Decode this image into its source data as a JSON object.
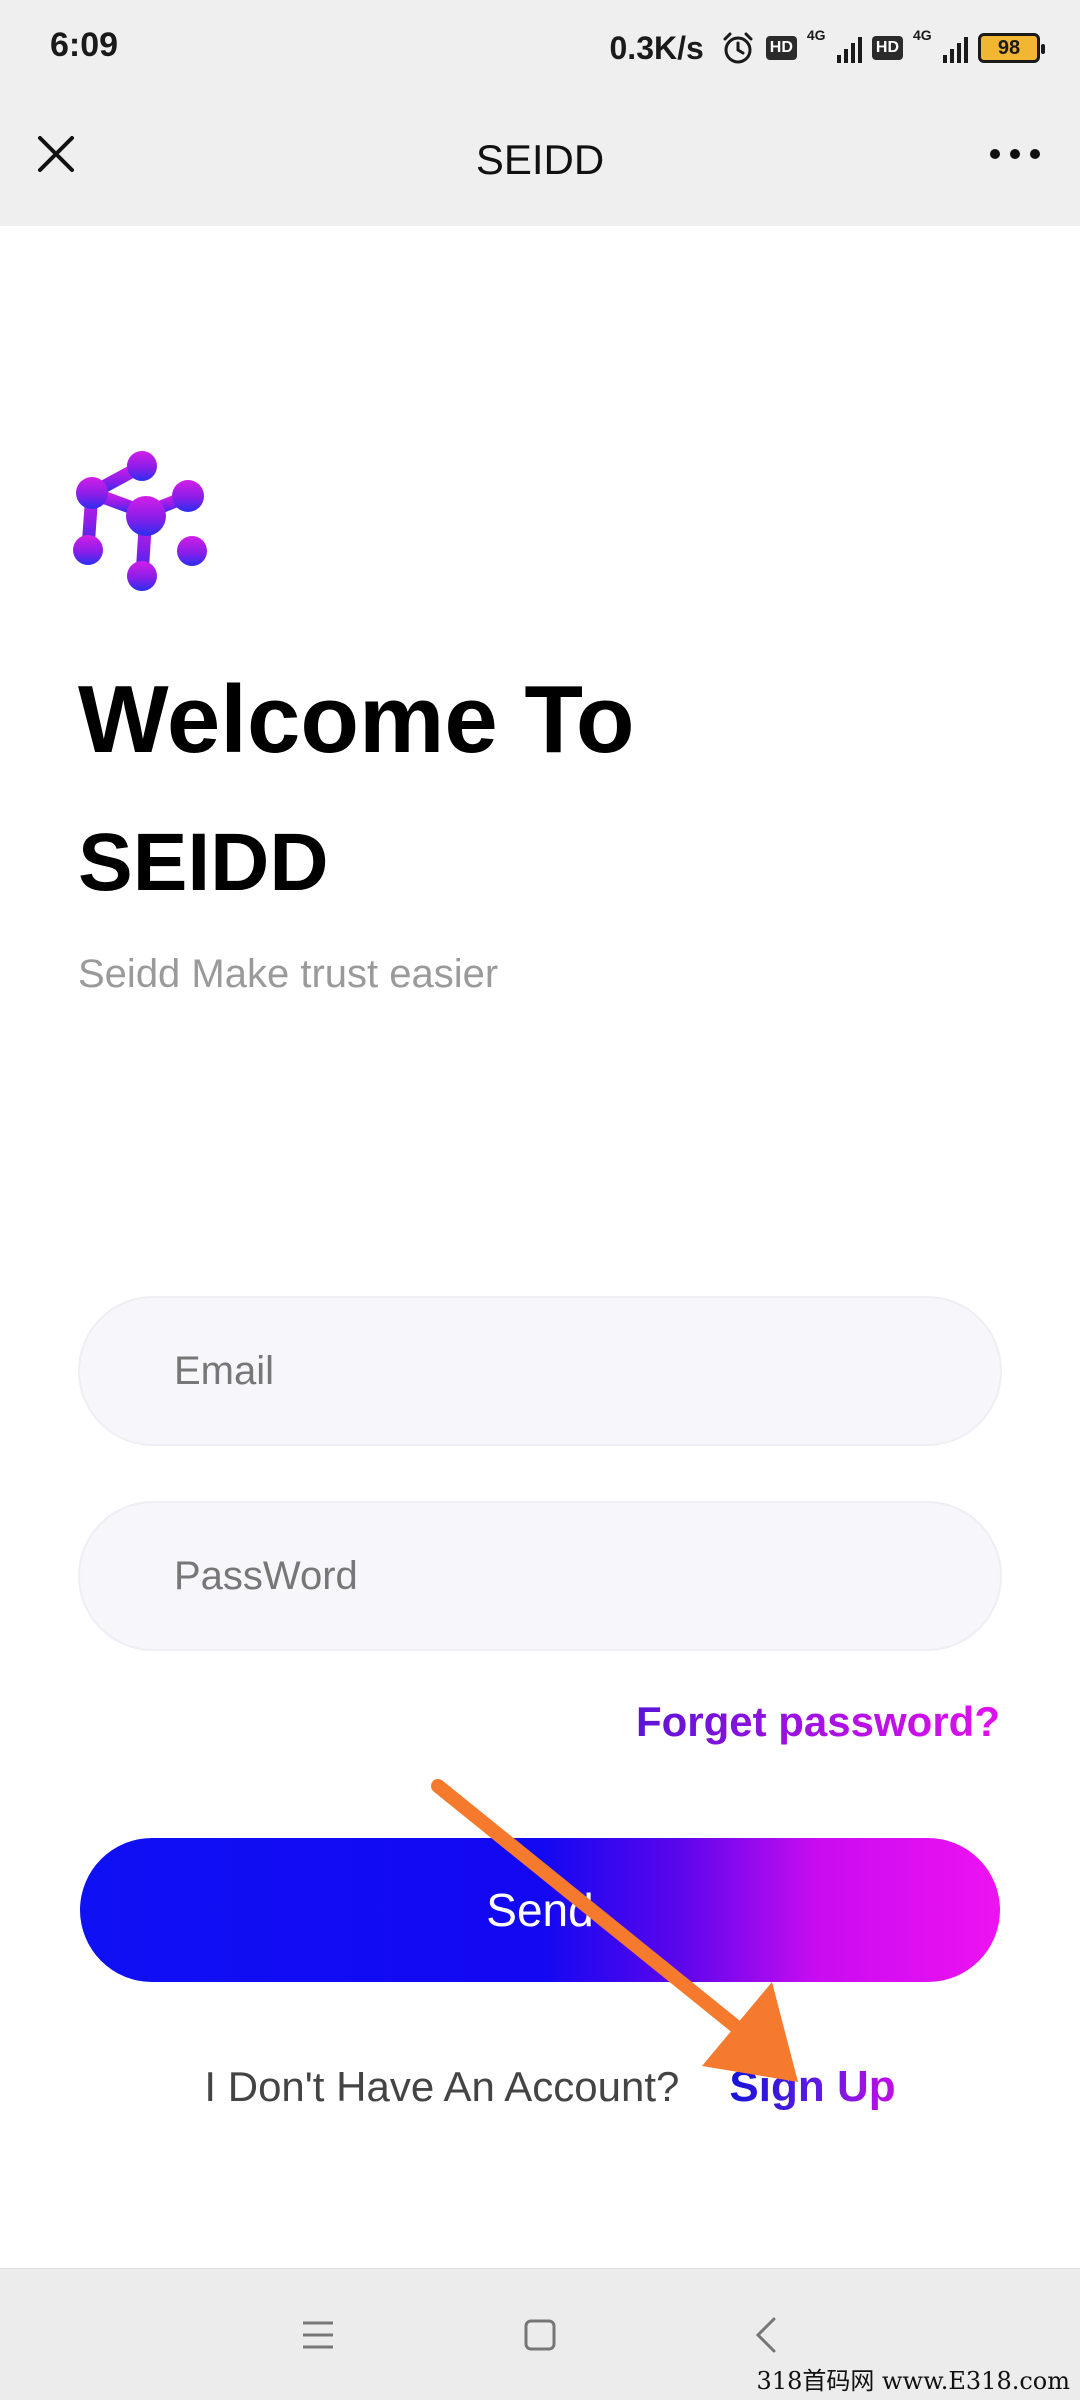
{
  "status_bar": {
    "time": "6:09",
    "net_speed": "0.3K/s",
    "hd_badge": "HD",
    "network_type": "4G",
    "battery_level": "98",
    "icons": [
      "alarm-icon",
      "hd-icon",
      "signal-4g-icon",
      "hd-icon",
      "signal-4g-icon",
      "battery-icon"
    ]
  },
  "title_bar": {
    "title": "SEIDD",
    "close_icon": "close-icon",
    "more_icon": "more-icon"
  },
  "main": {
    "logo_icon": "seidd-logo-icon",
    "welcome": "Welcome To",
    "brand": "SEIDD",
    "tagline": "Seidd Make trust easier",
    "email_placeholder": "Email",
    "password_placeholder": "PassWord",
    "forgot_password": "Forget password?",
    "send_label": "Send",
    "no_account": "I Don't Have An Account?",
    "sign_up": "Sign Up"
  },
  "annotation": {
    "arrow_color": "#f57a2e"
  },
  "nav_bar": {
    "icons": [
      "menu-icon",
      "home-icon",
      "back-icon"
    ]
  },
  "watermark": "318首码网 www.E318.com",
  "colors": {
    "gradient_start": "#1010f4",
    "gradient_end": "#ee12f2",
    "header_bg": "#efefef"
  }
}
